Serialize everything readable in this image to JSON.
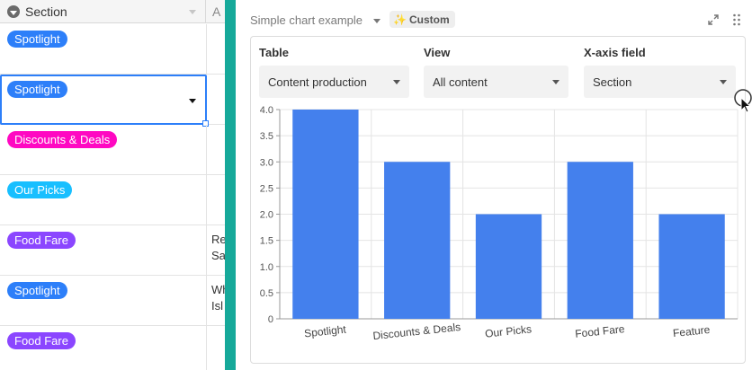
{
  "grid": {
    "header": {
      "section_label": "Section",
      "next_col_label": "A"
    },
    "rows": [
      {
        "tag": "Spotlight",
        "color": "#2d7ff9",
        "extra": "",
        "extra2": ""
      },
      {
        "tag": "Spotlight",
        "color": "#2d7ff9",
        "extra": "",
        "extra2": ""
      },
      {
        "tag": "Discounts & Deals",
        "color": "#ff08c2",
        "extra": "",
        "extra2": ""
      },
      {
        "tag": "Our Picks",
        "color": "#18bfff",
        "extra": "",
        "extra2": ""
      },
      {
        "tag": "Food Fare",
        "color": "#8b46ff",
        "extra": "Re",
        "extra2": "Sa"
      },
      {
        "tag": "Spotlight",
        "color": "#2d7ff9",
        "extra": "Wh",
        "extra2": "Isl"
      },
      {
        "tag": "Food Fare",
        "color": "#8b46ff",
        "extra": "",
        "extra2": ""
      }
    ]
  },
  "panel": {
    "title": "Simple chart example",
    "badge": {
      "icon": "sparkle-icon",
      "label": "Custom"
    },
    "fields": {
      "table": {
        "label": "Table",
        "value": "Content production"
      },
      "view": {
        "label": "View",
        "value": "All content"
      },
      "xaxis": {
        "label": "X-axis field",
        "value": "Section"
      }
    }
  },
  "colors": {
    "accent": "#2d7ff9",
    "divider": "#16a99a",
    "bar": "#4480ed"
  },
  "chart_data": {
    "type": "bar",
    "categories": [
      "Spotlight",
      "Discounts & Deals",
      "Our Picks",
      "Food Fare",
      "Feature"
    ],
    "values": [
      4,
      3,
      2,
      3,
      2
    ],
    "ylim": [
      0,
      4
    ],
    "yticks": [
      "0",
      "0.5",
      "1.0",
      "1.5",
      "2.0",
      "2.5",
      "3.0",
      "3.5",
      "4.0"
    ],
    "grid": true,
    "title": "",
    "xlabel": "",
    "ylabel": ""
  }
}
